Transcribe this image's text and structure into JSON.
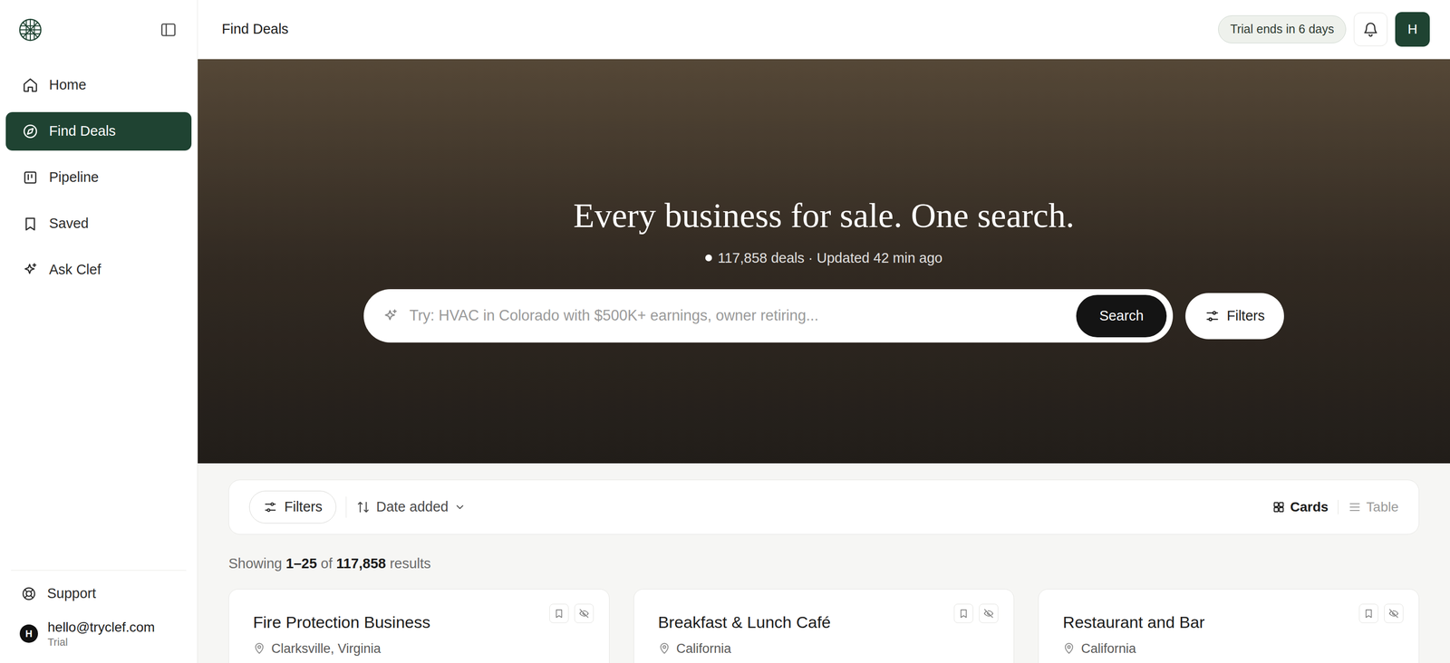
{
  "sidebar": {
    "items": [
      {
        "label": "Home",
        "selected": false
      },
      {
        "label": "Find Deals",
        "selected": true
      },
      {
        "label": "Pipeline",
        "selected": false
      },
      {
        "label": "Saved",
        "selected": false
      },
      {
        "label": "Ask Clef",
        "selected": false
      }
    ],
    "support": "Support",
    "user": {
      "avatar": "H",
      "email": "hello@tryclef.com",
      "plan": "Trial"
    }
  },
  "header": {
    "title": "Find Deals",
    "trial_badge": "Trial ends in 6 days",
    "avatar": "H"
  },
  "hero": {
    "title": "Every business for sale. One search.",
    "stats": "117,858 deals · Updated 42 min ago",
    "search": {
      "placeholder": "Try: HVAC in Colorado with $500K+ earnings, owner retiring...",
      "button": "Search"
    },
    "filters_button": "Filters"
  },
  "toolbar": {
    "filters": "Filters",
    "sort": "Date added",
    "views": [
      {
        "label": "Cards",
        "selected": true
      },
      {
        "label": "Table",
        "selected": false
      }
    ]
  },
  "results": {
    "prefix": "Showing",
    "range": "1–25",
    "of": "of",
    "total": "117,858",
    "suffix": "results"
  },
  "listings": [
    {
      "title": "Fire Protection Business",
      "location": "Clarksville, Virginia"
    },
    {
      "title": "Breakfast & Lunch Café",
      "location": "California"
    },
    {
      "title": "Restaurant and Bar",
      "location": "California"
    }
  ]
}
